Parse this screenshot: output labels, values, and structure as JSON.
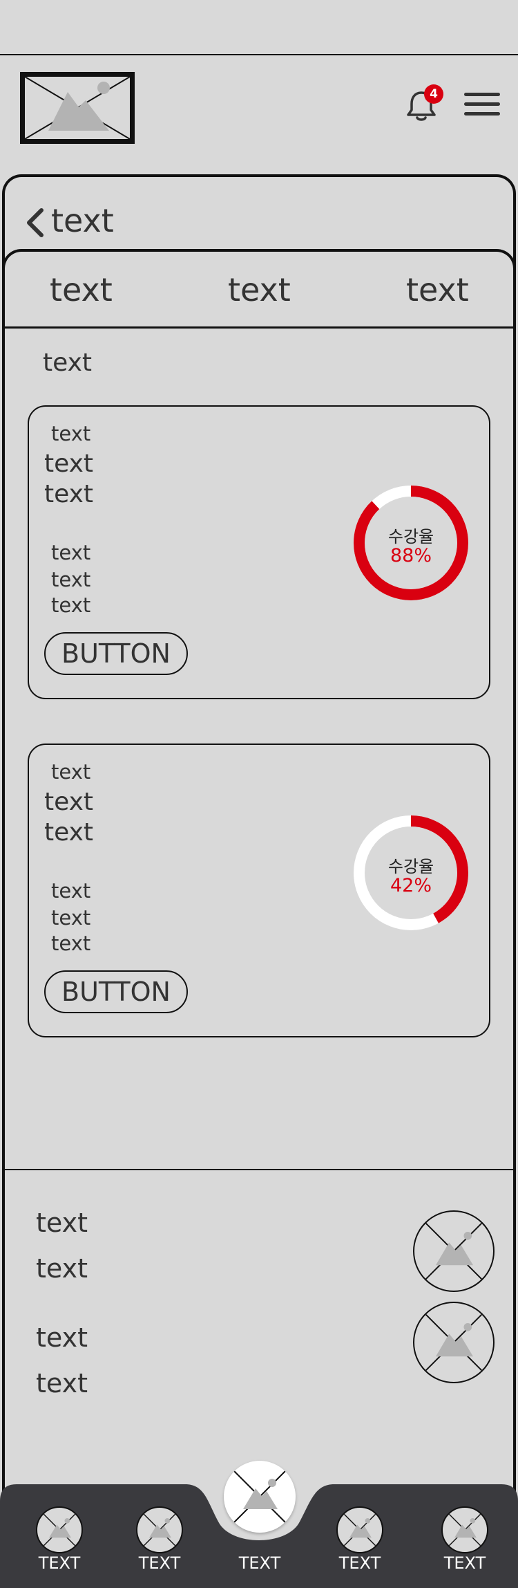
{
  "header": {
    "logo_icon": "image-placeholder-icon",
    "notification_icon": "bell-icon",
    "notification_count": "4",
    "menu_icon": "hamburger-menu-icon"
  },
  "page": {
    "back_icon": "chevron-left-icon",
    "title": "text"
  },
  "tabs": [
    {
      "label": "text"
    },
    {
      "label": "text"
    },
    {
      "label": "text"
    }
  ],
  "section_title": "text",
  "cards": [
    {
      "small_label": "text",
      "title_line1": "text",
      "title_line2": "text",
      "detail_lines": [
        "text",
        "text",
        "text"
      ],
      "button_label": "BUTTON",
      "progress_label": "수강율",
      "progress_text": "88%",
      "progress": 0.88
    },
    {
      "small_label": "text",
      "title_line1": "text",
      "title_line2": "text",
      "detail_lines": [
        "text",
        "text",
        "text"
      ],
      "button_label": "BUTTON",
      "progress_label": "수강율",
      "progress_text": "42%",
      "progress": 0.42
    }
  ],
  "list_items": [
    {
      "line1": "text",
      "line2": "text",
      "thumbnail_icon": "image-placeholder-icon"
    },
    {
      "line1": "text",
      "line2": "text",
      "thumbnail_icon": "image-placeholder-icon"
    }
  ],
  "bottom_nav": {
    "items": [
      {
        "label": "TEXT",
        "icon": "image-placeholder-icon"
      },
      {
        "label": "TEXT",
        "icon": "image-placeholder-icon"
      },
      {
        "label": "TEXT",
        "icon": "image-placeholder-icon"
      },
      {
        "label": "TEXT",
        "icon": "image-placeholder-icon"
      },
      {
        "label": "TEXT",
        "icon": "image-placeholder-icon"
      }
    ]
  },
  "colors": {
    "background": "#d9d9d9",
    "accent": "#d90010",
    "nav_background": "#3a3a3e"
  }
}
